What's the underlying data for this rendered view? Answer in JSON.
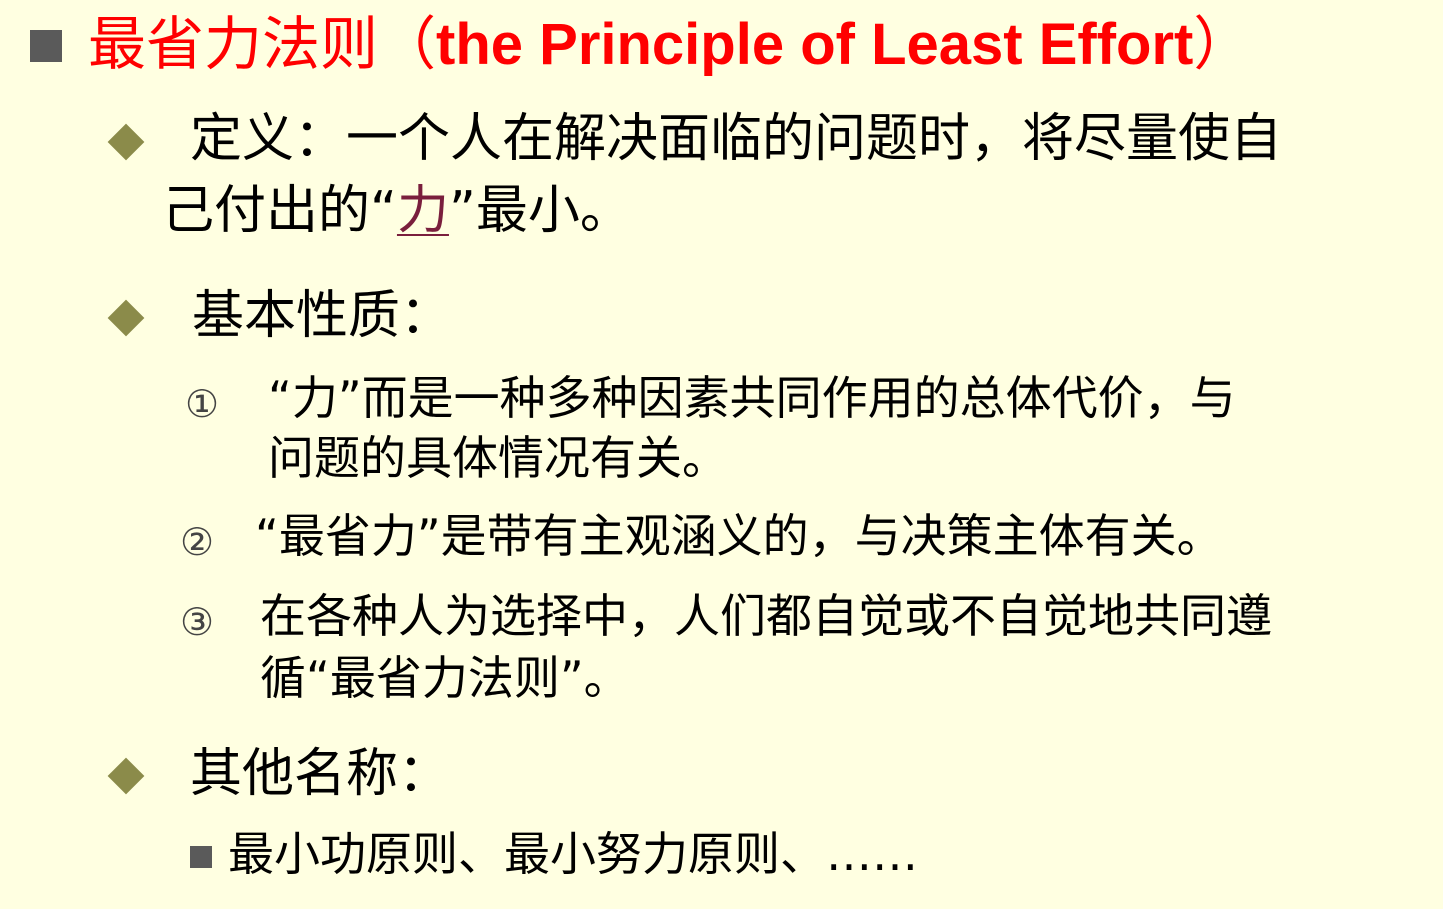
{
  "title": {
    "zh": "最省力法则（",
    "en": "the Principle of Least Effort",
    "close": "）"
  },
  "definition": {
    "line1": "定义：一个人在解决面临的问题时，将尽量使自",
    "line2_pre": "己付出的“",
    "line2_link": "力",
    "line2_post": "”最小。"
  },
  "properties": {
    "heading": "基本性质：",
    "items": [
      {
        "num": "①",
        "line1": "“力”而是一种多种因素共同作用的总体代价，与",
        "line2": "问题的具体情况有关。"
      },
      {
        "num": "②",
        "line1": "“最省力”是带有主观涵义的，与决策主体有关。"
      },
      {
        "num": "③",
        "line1": "在各种人为选择中，人们都自觉或不自觉地共同遵",
        "line2": "循“最省力法则”。"
      }
    ]
  },
  "other_names": {
    "heading": "其他名称：",
    "text": "最小功原则、最小努力原则、……"
  },
  "colors": {
    "background": "#FFFFE1",
    "title": "#FF0000",
    "diamond": "#8B8B4A",
    "link": "#7A1F3D"
  }
}
